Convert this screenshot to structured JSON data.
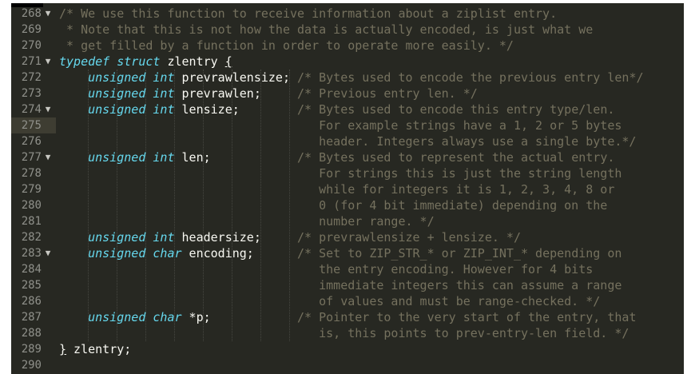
{
  "editor": {
    "theme_colors": {
      "background": "#272822",
      "text": "#f8f8f2",
      "keyword": "#66d9ef",
      "comment": "#75715e",
      "line_number": "#8f908a"
    },
    "lines": [
      {
        "n": "268",
        "fold": "▼",
        "segs": [
          {
            "t": "/* We use this function to receive information about a ziplist entry.",
            "c": "cm"
          }
        ]
      },
      {
        "n": "269",
        "fold": "",
        "segs": [
          {
            "t": " * Note that this is not how the data is actually encoded, is just what we",
            "c": "cm"
          }
        ]
      },
      {
        "n": "270",
        "fold": "",
        "segs": [
          {
            "t": " * get filled by a function in order to operate more easily. */",
            "c": "cm"
          }
        ]
      },
      {
        "n": "271",
        "fold": "▼",
        "segs": [
          {
            "t": "typedef struct",
            "c": "kw"
          },
          {
            "t": " zlentry ",
            "c": ""
          },
          {
            "t": "{",
            "c": "ul"
          }
        ]
      },
      {
        "n": "272",
        "fold": "",
        "segs": [
          {
            "t": "    ",
            "c": ""
          },
          {
            "t": "unsigned int",
            "c": "kw"
          },
          {
            "t": " prevrawlensize; ",
            "c": ""
          },
          {
            "t": "/* Bytes used to encode the previous entry len*/",
            "c": "cm"
          }
        ]
      },
      {
        "n": "273",
        "fold": "",
        "segs": [
          {
            "t": "    ",
            "c": ""
          },
          {
            "t": "unsigned int",
            "c": "kw"
          },
          {
            "t": " prevrawlen;     ",
            "c": ""
          },
          {
            "t": "/* Previous entry len. */",
            "c": "cm"
          }
        ]
      },
      {
        "n": "274",
        "fold": "▼",
        "segs": [
          {
            "t": "    ",
            "c": ""
          },
          {
            "t": "unsigned int",
            "c": "kw"
          },
          {
            "t": " lensize;        ",
            "c": ""
          },
          {
            "t": "/* Bytes used to encode this entry type/len.",
            "c": "cm"
          }
        ]
      },
      {
        "n": "275",
        "fold": "",
        "segs": [
          {
            "t": "                                    For example strings have a 1, 2 or 5 bytes",
            "c": "cm"
          }
        ]
      },
      {
        "n": "276",
        "fold": "",
        "segs": [
          {
            "t": "                                    header. Integers always use a single byte.*/",
            "c": "cm"
          }
        ]
      },
      {
        "n": "277",
        "fold": "▼",
        "segs": [
          {
            "t": "    ",
            "c": ""
          },
          {
            "t": "unsigned int",
            "c": "kw"
          },
          {
            "t": " len;            ",
            "c": ""
          },
          {
            "t": "/* Bytes used to represent the actual entry.",
            "c": "cm"
          }
        ]
      },
      {
        "n": "278",
        "fold": "",
        "segs": [
          {
            "t": "                                    For strings this is just the string length",
            "c": "cm"
          }
        ]
      },
      {
        "n": "279",
        "fold": "",
        "segs": [
          {
            "t": "                                    while for integers it is 1, 2, 3, 4, 8 or",
            "c": "cm"
          }
        ]
      },
      {
        "n": "280",
        "fold": "",
        "segs": [
          {
            "t": "                                    0 (for 4 bit immediate) depending on the",
            "c": "cm"
          }
        ]
      },
      {
        "n": "281",
        "fold": "",
        "segs": [
          {
            "t": "                                    number range. */",
            "c": "cm"
          }
        ]
      },
      {
        "n": "282",
        "fold": "",
        "segs": [
          {
            "t": "    ",
            "c": ""
          },
          {
            "t": "unsigned int",
            "c": "kw"
          },
          {
            "t": " headersize;     ",
            "c": ""
          },
          {
            "t": "/* prevrawlensize + lensize. */",
            "c": "cm"
          }
        ]
      },
      {
        "n": "283",
        "fold": "▼",
        "segs": [
          {
            "t": "    ",
            "c": ""
          },
          {
            "t": "unsigned char",
            "c": "kw"
          },
          {
            "t": " encoding;      ",
            "c": ""
          },
          {
            "t": "/* Set to ZIP_STR_* or ZIP_INT_* depending on",
            "c": "cm"
          }
        ]
      },
      {
        "n": "284",
        "fold": "",
        "segs": [
          {
            "t": "                                    the entry encoding. However for 4 bits",
            "c": "cm"
          }
        ]
      },
      {
        "n": "285",
        "fold": "",
        "segs": [
          {
            "t": "                                    immediate integers this can assume a range",
            "c": "cm"
          }
        ]
      },
      {
        "n": "286",
        "fold": "",
        "segs": [
          {
            "t": "                                    of values and must be range-checked. */",
            "c": "cm"
          }
        ]
      },
      {
        "n": "287",
        "fold": "",
        "segs": [
          {
            "t": "    ",
            "c": ""
          },
          {
            "t": "unsigned char",
            "c": "kw"
          },
          {
            "t": " *p;            ",
            "c": ""
          },
          {
            "t": "/* Pointer to the very start of the entry, that",
            "c": "cm"
          }
        ]
      },
      {
        "n": "288",
        "fold": "",
        "segs": [
          {
            "t": "                                    is, this points to prev-entry-len field. */",
            "c": "cm"
          }
        ]
      },
      {
        "n": "289",
        "fold": "",
        "segs": [
          {
            "t": "}",
            "c": "ul"
          },
          {
            "t": " zlentry;",
            "c": ""
          }
        ]
      },
      {
        "n": "290",
        "fold": "",
        "segs": []
      }
    ]
  }
}
